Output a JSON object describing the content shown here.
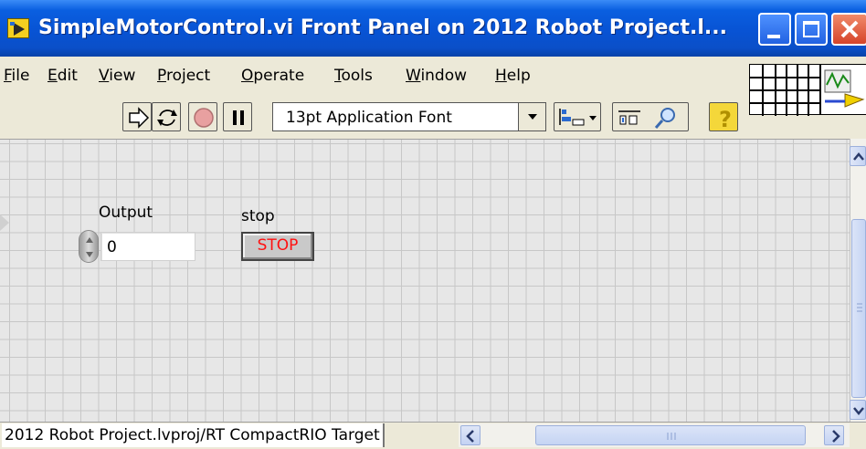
{
  "window": {
    "title": "SimpleMotorControl.vi Front Panel on 2012 Robot Project.l..."
  },
  "menu": [
    {
      "label": "File",
      "accel": "F",
      "rest": "ile"
    },
    {
      "label": "Edit",
      "accel": "E",
      "rest": "dit"
    },
    {
      "label": "View",
      "accel": "V",
      "rest": "iew"
    },
    {
      "label": "Project",
      "accel": "P",
      "rest": "roject"
    },
    {
      "label": "Operate",
      "accel": "O",
      "rest": "perate"
    },
    {
      "label": "Tools",
      "accel": "T",
      "rest": "ools"
    },
    {
      "label": "Window",
      "accel": "W",
      "rest": "indow"
    },
    {
      "label": "Help",
      "accel": "H",
      "rest": "elp"
    }
  ],
  "toolbar": {
    "font_setting": "13pt Application Font",
    "icons": [
      "run-arrow-icon",
      "run-continuously-icon",
      "abort-icon",
      "pause-icon",
      "align-objects-icon",
      "distribute-objects-icon",
      "search-icon",
      "context-help-icon"
    ]
  },
  "controls": {
    "output": {
      "label": "Output",
      "value": "0"
    },
    "stop": {
      "label": "stop",
      "button_text": "STOP"
    }
  },
  "status": {
    "context": "2012 Robot Project.lvproj/RT CompactRIO Target"
  },
  "colors": {
    "titlebar": "#0853d4",
    "stop_text": "#ff1010",
    "panel_bg": "#e7e7e7",
    "grid_line": "#c7c7c7"
  }
}
